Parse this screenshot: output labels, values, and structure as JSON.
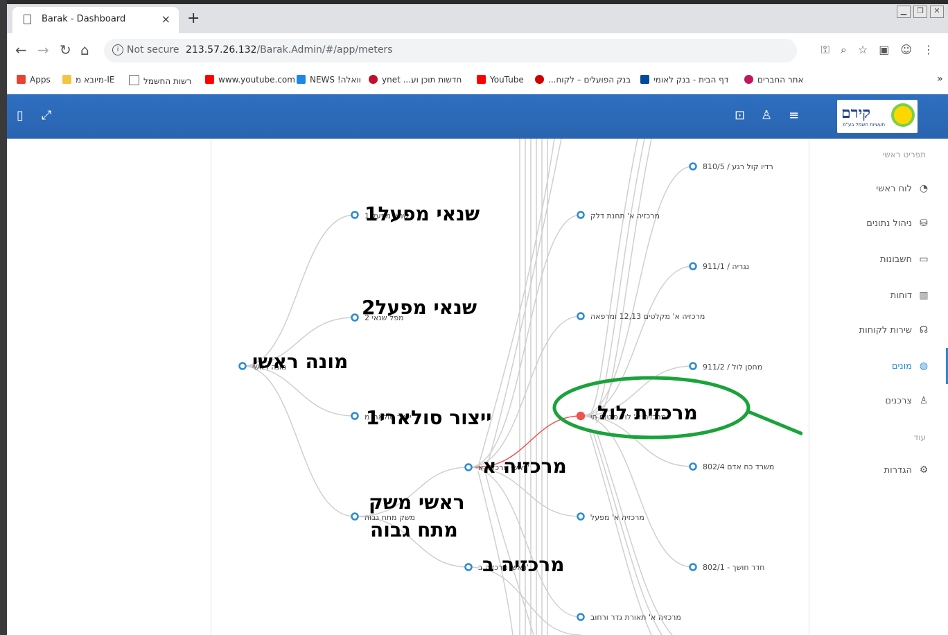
{
  "browser": {
    "tab_title": "Barak - Dashboard",
    "tab_close": "×",
    "new_tab": "+",
    "security": "Not secure",
    "url_host": "213.57.26.132",
    "url_path": "/Barak.Admin/#/app/meters",
    "bookmarks": [
      {
        "label": "Apps",
        "color": "#e94235"
      },
      {
        "label": "מיובא מ-IE",
        "color": "#f4c542"
      },
      {
        "label": "רשות החשמל",
        "color": "#ffffff"
      },
      {
        "label": "www.youtube.com",
        "color": "#ff0000"
      },
      {
        "label": "NEWS !וואלה",
        "color": "#1e88e5"
      },
      {
        "label": "ynet ...חדשות תוכן וע",
        "color": "#c0102b"
      },
      {
        "label": "YouTube",
        "color": "#ff0000"
      },
      {
        "label": "...בנק הפועלים – לקוח",
        "color": "#d00000"
      },
      {
        "label": "דף הבית - בנק לאומי",
        "color": "#004a98"
      },
      {
        "label": "אתר החברים",
        "color": "#c2185b"
      }
    ]
  },
  "header": {
    "logo_text": "קירם",
    "logo_sub": "תעשיות חשמל בע\"מ"
  },
  "sidebar": {
    "section_main": "תפריט ראשי",
    "section_more": "עוד",
    "items": [
      {
        "label": "לוח ראשי",
        "icon": "◔"
      },
      {
        "label": "ניהול נתונים",
        "icon": "⛁"
      },
      {
        "label": "חשבונות",
        "icon": "▭"
      },
      {
        "label": "דוחות",
        "icon": "▥"
      },
      {
        "label": "שירות לקוחות",
        "icon": "☊"
      },
      {
        "label": "מונים",
        "icon": "◍"
      },
      {
        "label": "צרכנים",
        "icon": "♙"
      },
      {
        "label": "הגדרות",
        "icon": "⚙"
      }
    ]
  },
  "tree": {
    "root": {
      "label": "מונה ראשי",
      "big": "מונה ראשי"
    },
    "level1": [
      {
        "label": "שנאי מפעל 1",
        "big": "שנאי מפעל1"
      },
      {
        "label": "מפל שנאי 2",
        "big": "שנאי מפעל2"
      },
      {
        "label": "ייצור סולארי מ",
        "big": "ייצור סולארי1"
      },
      {
        "label": "משק מתח גבוה",
        "big_line1": "ראשי משק",
        "big_line2": "מתח גבוה"
      }
    ],
    "level2": [
      {
        "label": "ראשי מרכזיה א'",
        "big": "מרכזיה א"
      },
      {
        "label": "ראשי מרכזיה ב'",
        "big": "מרכזיה ב"
      }
    ],
    "level3": [
      {
        "label": "מרכזיה א' תחנת דלק"
      },
      {
        "label": "מרכזיה א' מקלטים 12,13 ומרפאה"
      },
      {
        "label": "מרכזיה א' לול פיטום חי",
        "big": "מרכזית לול"
      },
      {
        "label": "מרכזיה א' מפעל"
      },
      {
        "label": "מרכזיה א' תאורת גדר ורחוב"
      }
    ],
    "level4": [
      {
        "label": "810/5 / רדיו קול רגע"
      },
      {
        "label": "911/1 / נגריה"
      },
      {
        "label": "911/2 / מחסן לול"
      },
      {
        "label": "802/4 משרד כח אדם"
      },
      {
        "label": "802/1 - חדר חושך"
      }
    ]
  },
  "colors": {
    "highlight": "#1aa33a",
    "active_edge": "#ef5350",
    "node": "#2a8ad4"
  }
}
